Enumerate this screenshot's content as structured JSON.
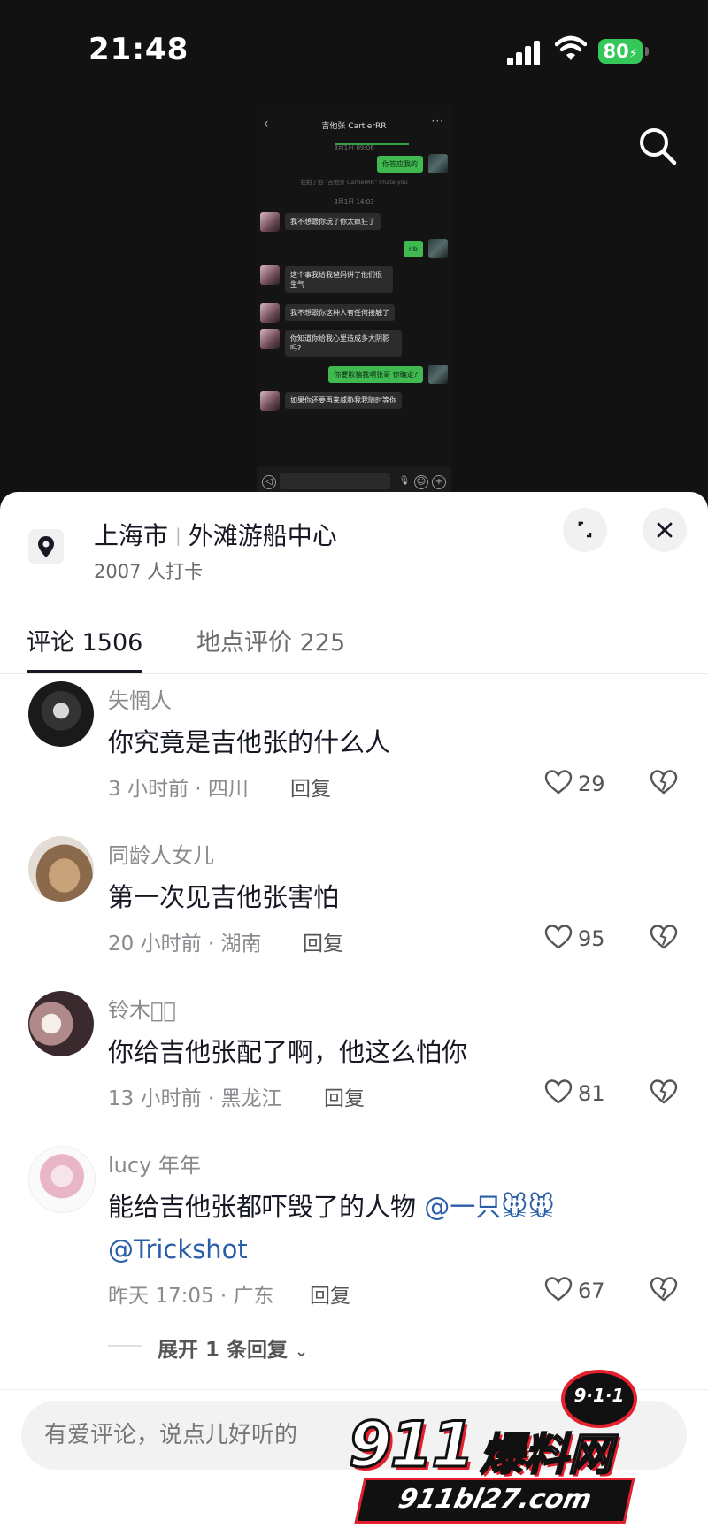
{
  "status_bar": {
    "time": "21:48",
    "battery": "80"
  },
  "chat_screenshot": {
    "title": "吉他张 CartlerRR",
    "time1": "3月1日 09:06",
    "msg_me_1": "你答应我的",
    "system_note": "我拍了拍 \"吉他张 CartlerRR\" I hate you",
    "time2": "3月1日 14:03",
    "msg_them_1": "我不想跟你玩了你太疯狂了",
    "msg_me_2": "nb",
    "msg_them_2": "这个事我给我爸妈讲了他们很生气",
    "msg_them_3": "我不想跟你这种人有任何接触了",
    "msg_them_4": "你知道你给我心里造成多大阴影吗?",
    "msg_me_3": "你要欺骗我啊张哥 你确定?",
    "msg_them_5": "如果你还要再来威胁我我随时等你"
  },
  "location": {
    "city": "上海市",
    "place": "外滩游船中心",
    "checkins": "2007 人打卡"
  },
  "tabs": {
    "comments": "评论 1506",
    "reviews": "地点评价 225"
  },
  "comments": [
    {
      "name": "失惘人",
      "text": "你究竟是吉他张的什么人",
      "meta": "3 小时前 · 四川",
      "reply": "回复",
      "likes": "29"
    },
    {
      "name": "同龄人女儿",
      "text": "第一次见吉他张害怕",
      "meta": "20 小时前 · 湖南",
      "reply": "回复",
      "likes": "95"
    },
    {
      "name": "铃木透ͧ",
      "text": "你给吉他张配了啊，他这么怕你",
      "meta": "13 小时前 · 黑龙江",
      "reply": "回复",
      "likes": "81"
    },
    {
      "name": "lucy 年年",
      "text": "能给吉他张都吓毁了的人物",
      "mention1": "@一只🐭🐭",
      "mention2": "@Trickshot",
      "meta": "昨天 17:05 · 广东",
      "reply": "回复",
      "likes": "67"
    }
  ],
  "expand_replies": "展开 1 条回复",
  "comment_input": {
    "placeholder": "有爱评论，说点儿好听的"
  },
  "watermark": {
    "badge": "9·1·1",
    "brand_num": "911",
    "brand_cn": "爆料网",
    "url": "911bl27.com"
  }
}
